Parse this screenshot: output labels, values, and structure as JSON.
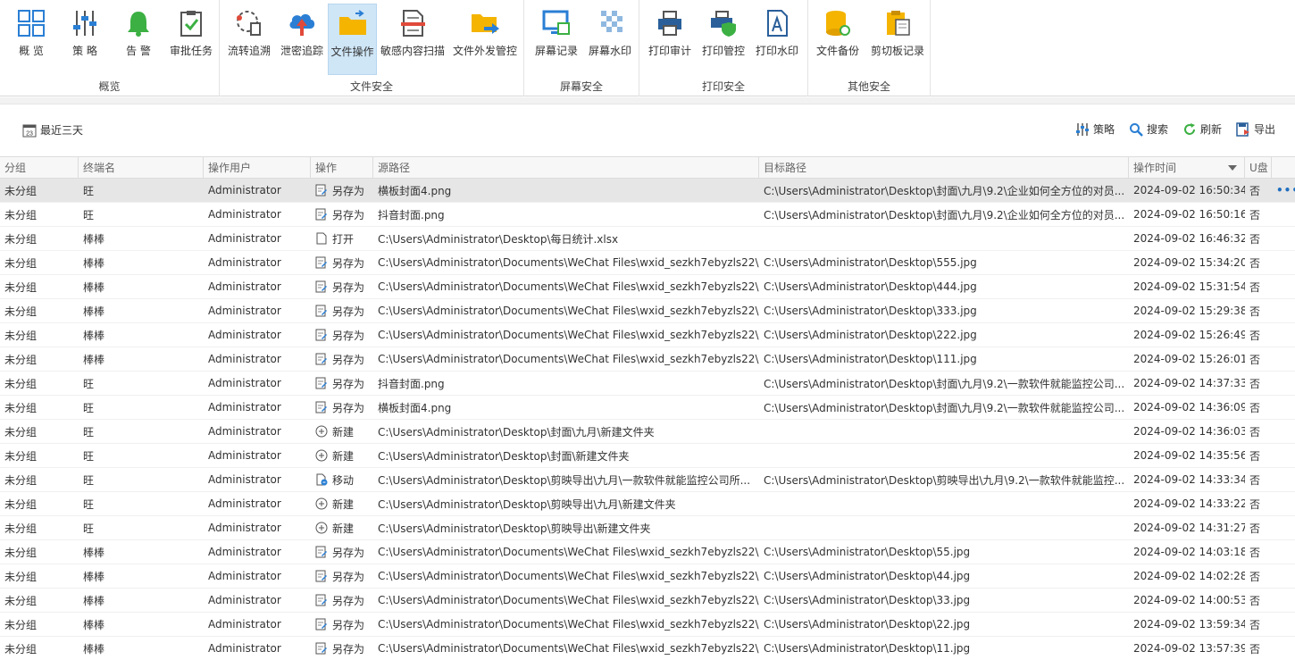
{
  "ribbon": {
    "groups": [
      {
        "label": "概览",
        "buttons": [
          "概 览",
          "策 略",
          "告 警",
          "审批任务"
        ]
      },
      {
        "label": "文件安全",
        "buttons": [
          "流转追溯",
          "泄密追踪",
          "文件操作",
          "敏感内容扫描",
          "文件外发管控"
        ]
      },
      {
        "label": "屏幕安全",
        "buttons": [
          "屏幕记录",
          "屏幕水印"
        ]
      },
      {
        "label": "打印安全",
        "buttons": [
          "打印审计",
          "打印管控",
          "打印水印"
        ]
      },
      {
        "label": "其他安全",
        "buttons": [
          "文件备份",
          "剪切板记录"
        ]
      }
    ],
    "active": "文件操作"
  },
  "toolbar": {
    "date_icon_text": "23",
    "date_range": "最近三天",
    "strategy": "策略",
    "search": "搜索",
    "refresh": "刷新",
    "export": "导出"
  },
  "table": {
    "columns": [
      "分组",
      "终端名",
      "操作用户",
      "操作",
      "源路径",
      "目标路径",
      "操作时间",
      "U盘"
    ],
    "row_more": "•••",
    "rows": [
      [
        "未分组",
        "旺",
        "Administrator",
        "另存为",
        "横板封面4.png",
        "C:\\Users\\Administrator\\Desktop\\封面\\九月\\9.2\\企业如何全方位的对员...",
        "2024-09-02 16:50:34",
        "否"
      ],
      [
        "未分组",
        "旺",
        "Administrator",
        "另存为",
        "抖音封面.png",
        "C:\\Users\\Administrator\\Desktop\\封面\\九月\\9.2\\企业如何全方位的对员...",
        "2024-09-02 16:50:16",
        "否"
      ],
      [
        "未分组",
        "棒棒",
        "Administrator",
        "打开",
        "C:\\Users\\Administrator\\Desktop\\每日统计.xlsx",
        "",
        "2024-09-02 16:46:32",
        "否"
      ],
      [
        "未分组",
        "棒棒",
        "Administrator",
        "另存为",
        "C:\\Users\\Administrator\\Documents\\WeChat Files\\wxid_sezkh7ebyzls22\\...",
        "C:\\Users\\Administrator\\Desktop\\555.jpg",
        "2024-09-02 15:34:20",
        "否"
      ],
      [
        "未分组",
        "棒棒",
        "Administrator",
        "另存为",
        "C:\\Users\\Administrator\\Documents\\WeChat Files\\wxid_sezkh7ebyzls22\\...",
        "C:\\Users\\Administrator\\Desktop\\444.jpg",
        "2024-09-02 15:31:54",
        "否"
      ],
      [
        "未分组",
        "棒棒",
        "Administrator",
        "另存为",
        "C:\\Users\\Administrator\\Documents\\WeChat Files\\wxid_sezkh7ebyzls22\\...",
        "C:\\Users\\Administrator\\Desktop\\333.jpg",
        "2024-09-02 15:29:38",
        "否"
      ],
      [
        "未分组",
        "棒棒",
        "Administrator",
        "另存为",
        "C:\\Users\\Administrator\\Documents\\WeChat Files\\wxid_sezkh7ebyzls22\\...",
        "C:\\Users\\Administrator\\Desktop\\222.jpg",
        "2024-09-02 15:26:49",
        "否"
      ],
      [
        "未分组",
        "棒棒",
        "Administrator",
        "另存为",
        "C:\\Users\\Administrator\\Documents\\WeChat Files\\wxid_sezkh7ebyzls22\\...",
        "C:\\Users\\Administrator\\Desktop\\111.jpg",
        "2024-09-02 15:26:01",
        "否"
      ],
      [
        "未分组",
        "旺",
        "Administrator",
        "另存为",
        "抖音封面.png",
        "C:\\Users\\Administrator\\Desktop\\封面\\九月\\9.2\\一款软件就能监控公司...",
        "2024-09-02 14:37:33",
        "否"
      ],
      [
        "未分组",
        "旺",
        "Administrator",
        "另存为",
        "横板封面4.png",
        "C:\\Users\\Administrator\\Desktop\\封面\\九月\\9.2\\一款软件就能监控公司...",
        "2024-09-02 14:36:09",
        "否"
      ],
      [
        "未分组",
        "旺",
        "Administrator",
        "新建",
        "C:\\Users\\Administrator\\Desktop\\封面\\九月\\新建文件夹",
        "",
        "2024-09-02 14:36:03",
        "否"
      ],
      [
        "未分组",
        "旺",
        "Administrator",
        "新建",
        "C:\\Users\\Administrator\\Desktop\\封面\\新建文件夹",
        "",
        "2024-09-02 14:35:56",
        "否"
      ],
      [
        "未分组",
        "旺",
        "Administrator",
        "移动",
        "C:\\Users\\Administrator\\Desktop\\剪映导出\\九月\\一款软件就能监控公司所...",
        "C:\\Users\\Administrator\\Desktop\\剪映导出\\九月\\9.2\\一款软件就能监控...",
        "2024-09-02 14:33:34",
        "否"
      ],
      [
        "未分组",
        "旺",
        "Administrator",
        "新建",
        "C:\\Users\\Administrator\\Desktop\\剪映导出\\九月\\新建文件夹",
        "",
        "2024-09-02 14:33:22",
        "否"
      ],
      [
        "未分组",
        "旺",
        "Administrator",
        "新建",
        "C:\\Users\\Administrator\\Desktop\\剪映导出\\新建文件夹",
        "",
        "2024-09-02 14:31:27",
        "否"
      ],
      [
        "未分组",
        "棒棒",
        "Administrator",
        "另存为",
        "C:\\Users\\Administrator\\Documents\\WeChat Files\\wxid_sezkh7ebyzls22\\...",
        "C:\\Users\\Administrator\\Desktop\\55.jpg",
        "2024-09-02 14:03:18",
        "否"
      ],
      [
        "未分组",
        "棒棒",
        "Administrator",
        "另存为",
        "C:\\Users\\Administrator\\Documents\\WeChat Files\\wxid_sezkh7ebyzls22\\...",
        "C:\\Users\\Administrator\\Desktop\\44.jpg",
        "2024-09-02 14:02:28",
        "否"
      ],
      [
        "未分组",
        "棒棒",
        "Administrator",
        "另存为",
        "C:\\Users\\Administrator\\Documents\\WeChat Files\\wxid_sezkh7ebyzls22\\...",
        "C:\\Users\\Administrator\\Desktop\\33.jpg",
        "2024-09-02 14:00:53",
        "否"
      ],
      [
        "未分组",
        "棒棒",
        "Administrator",
        "另存为",
        "C:\\Users\\Administrator\\Documents\\WeChat Files\\wxid_sezkh7ebyzls22\\...",
        "C:\\Users\\Administrator\\Desktop\\22.jpg",
        "2024-09-02 13:59:34",
        "否"
      ],
      [
        "未分组",
        "棒棒",
        "Administrator",
        "另存为",
        "C:\\Users\\Administrator\\Documents\\WeChat Files\\wxid_sezkh7ebyzls22\\...",
        "C:\\Users\\Administrator\\Desktop\\11.jpg",
        "2024-09-02 13:57:39",
        "否"
      ]
    ]
  }
}
